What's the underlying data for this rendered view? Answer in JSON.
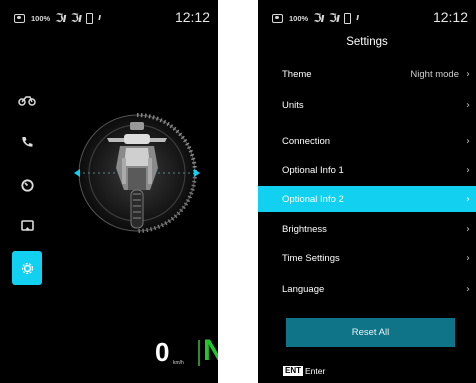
{
  "status": {
    "battery_pct": "100%",
    "time": "12:12"
  },
  "left": {
    "sidebar": [
      {
        "icon": "motorcycle-icon"
      },
      {
        "icon": "phone-icon"
      },
      {
        "icon": "gauge-icon"
      },
      {
        "icon": "cast-icon"
      },
      {
        "icon": "gear-icon",
        "active": true
      }
    ],
    "speed": "0",
    "speed_unit": "km/h",
    "gear": "N"
  },
  "settings": {
    "title": "Settings",
    "items": [
      {
        "label": "Theme",
        "value": "Night mode"
      },
      {
        "label": "Units",
        "value": ""
      },
      {
        "label": "Connection",
        "value": ""
      },
      {
        "label": "Optional Info 1",
        "value": ""
      },
      {
        "label": "Optional Info 2",
        "value": "",
        "selected": true
      },
      {
        "label": "Brightness",
        "value": ""
      },
      {
        "label": "Time Settings",
        "value": ""
      },
      {
        "label": "Language",
        "value": ""
      }
    ],
    "reset_label": "Reset All",
    "ent_key": "ENT",
    "ent_label": "Enter"
  },
  "colors": {
    "accent": "#12d0f0",
    "gear": "#22c52c",
    "reset": "#0f7487"
  }
}
